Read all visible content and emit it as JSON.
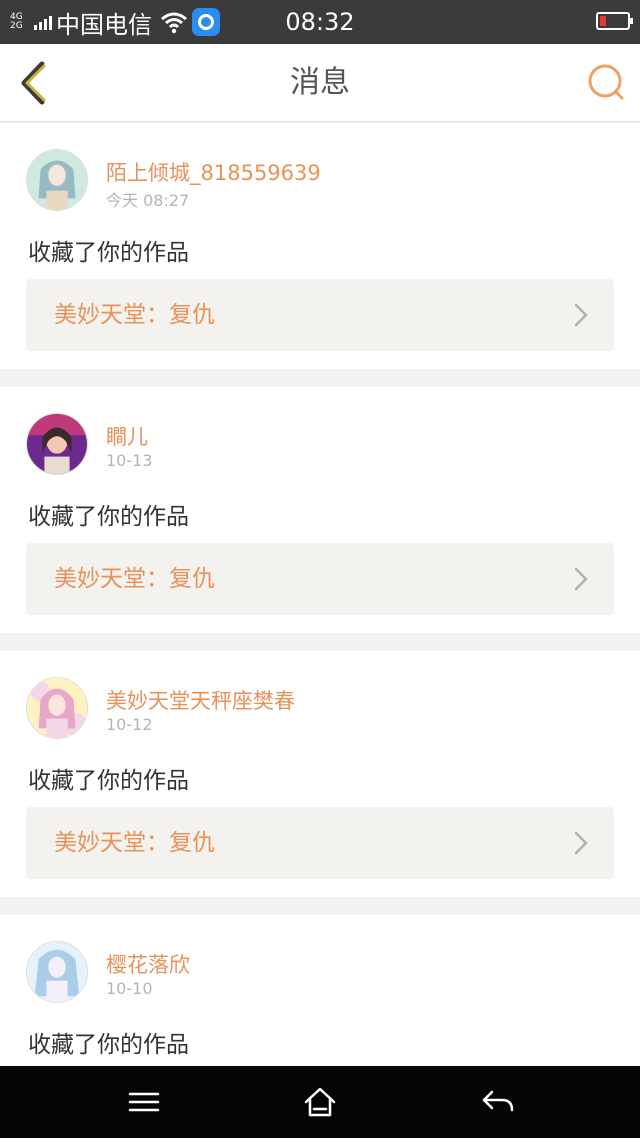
{
  "status_bar": {
    "network_label": "4G\n2G",
    "carrier": "中国电信",
    "time": "08:32",
    "battery_color": "#e53935"
  },
  "header": {
    "title": "消息",
    "back_icon": "chevron-left-icon",
    "search_icon": "search-icon"
  },
  "messages": [
    {
      "user": "陌上倾城_818559639",
      "time": "今天 08:27",
      "action": "收藏了你的作品",
      "work": "美妙天堂：复仇",
      "avatar_colors": [
        "#cfe8e0",
        "#7aa6b8",
        "#e7d9c2"
      ]
    },
    {
      "user": "瞷儿",
      "time": "10-13",
      "action": "收藏了你的作品",
      "work": "美妙天堂：复仇",
      "avatar_colors": [
        "#6b2a8c",
        "#f2c8b4",
        "#3a2a2a"
      ]
    },
    {
      "user": "美妙天堂天秤座樊春",
      "time": "10-12",
      "action": "收藏了你的作品",
      "work": "美妙天堂：复仇",
      "avatar_colors": [
        "#f3d7e6",
        "#e8a7c8",
        "#fff2c2"
      ]
    },
    {
      "user": "樱花落欣",
      "time": "10-10",
      "action": "收藏了你的作品",
      "work": "",
      "avatar_colors": [
        "#e6f2fb",
        "#a9cde6",
        "#f5f0f7"
      ]
    }
  ],
  "nav_bar": {
    "menu_icon": "menu-icon",
    "home_icon": "home-icon",
    "back_icon": "back-arrow-icon"
  },
  "colors": {
    "accent": "#e8925a",
    "back_icon": "#c9b23a"
  }
}
